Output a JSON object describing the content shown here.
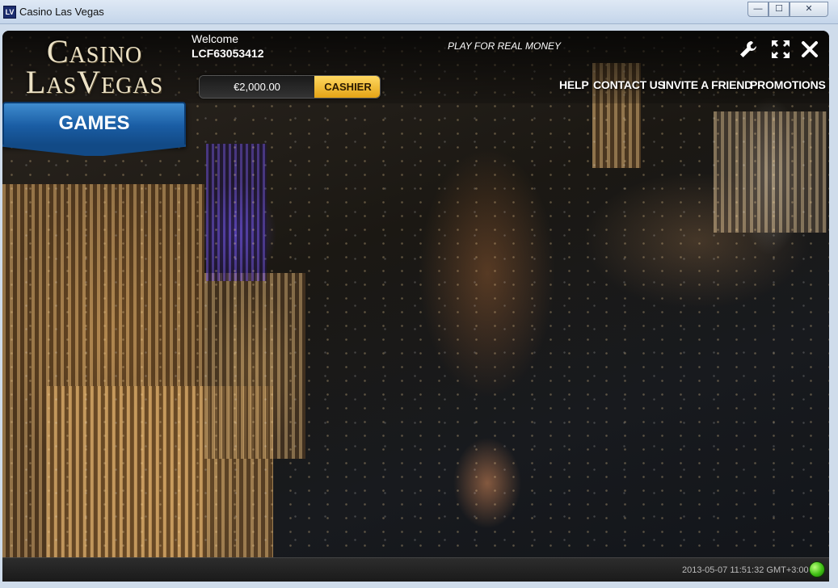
{
  "window": {
    "title": "Casino Las Vegas",
    "icon_label": "LV",
    "controls": {
      "minimize": "—",
      "maximize": "☐",
      "close": "✕"
    }
  },
  "logo": {
    "line1": "Casino",
    "line2": "LasVegas"
  },
  "account": {
    "welcome_label": "Welcome",
    "username": "LCF63053412",
    "balance": "€2,000.00",
    "cashier_label": "CASHIER"
  },
  "promo_text": "PLAY FOR REAL MONEY",
  "toolbar": {
    "icons": [
      "wrench-icon",
      "fullscreen-icon",
      "close-icon"
    ]
  },
  "nav": [
    {
      "label": "HELP"
    },
    {
      "label": "CONTACT US"
    },
    {
      "label": "INVITE A FRIEND"
    },
    {
      "label": "PROMOTIONS"
    }
  ],
  "games_tab": {
    "label": "GAMES"
  },
  "status": {
    "timestamp": "2013-05-07 11:51:32 GMT+3:00",
    "connection_color": "#3fbf14"
  },
  "colors": {
    "accent_gold": "#e4a315",
    "tab_blue": "#1a5da4"
  }
}
